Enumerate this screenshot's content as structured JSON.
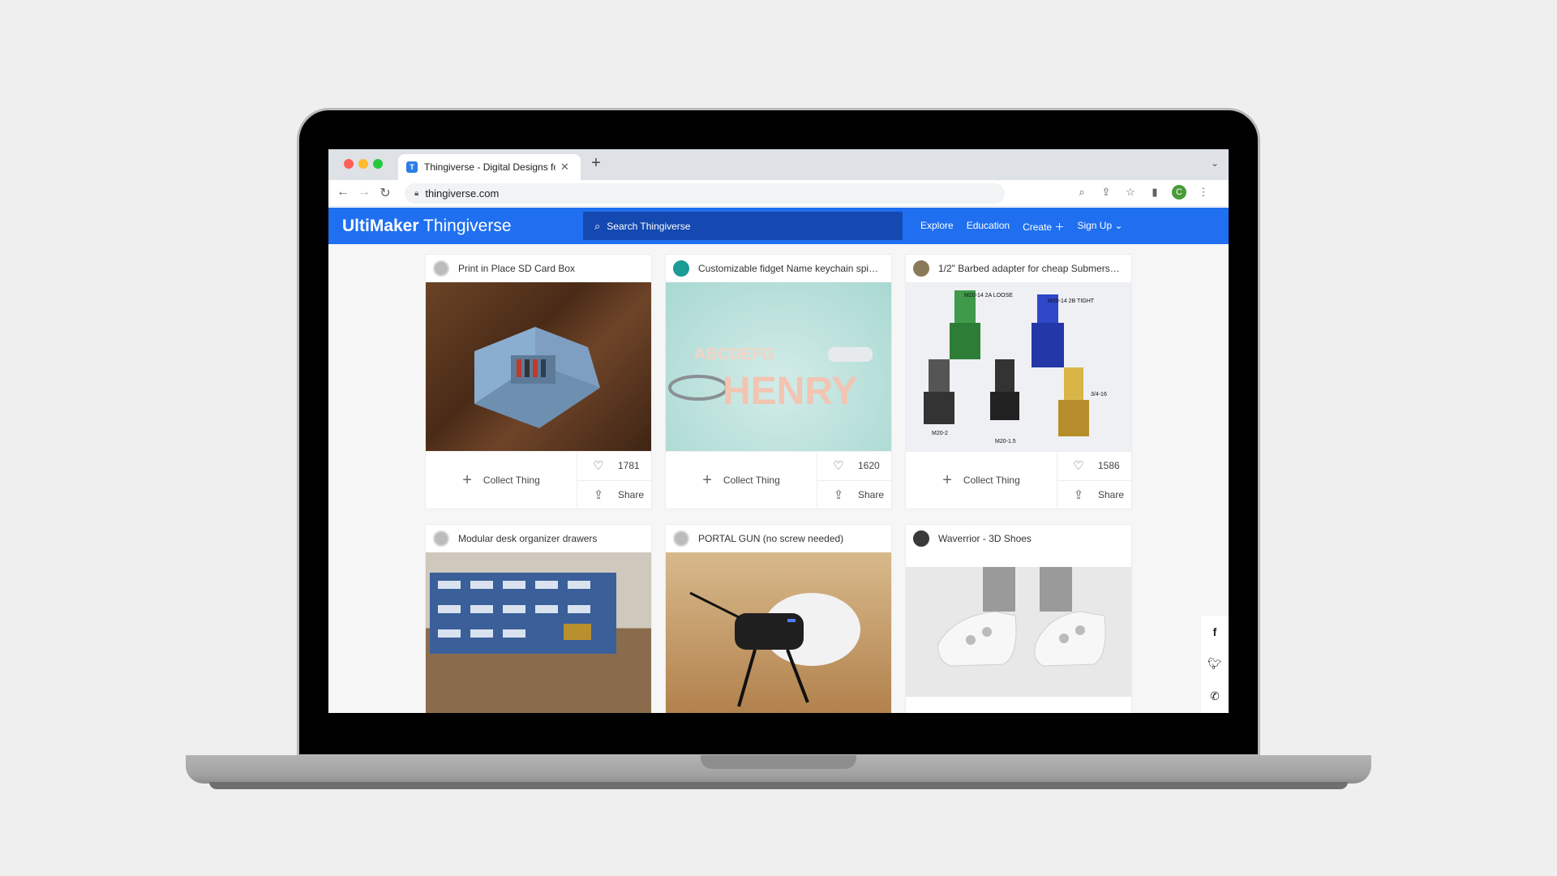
{
  "browser": {
    "tab_title": "Thingiverse - Digital Designs fo",
    "tab_favicon": "T",
    "url": "thingiverse.com",
    "profile_initial": "C"
  },
  "header": {
    "logo_bold": "UltiMaker",
    "logo_light": " Thingiverse",
    "search_placeholder": "Search Thingiverse",
    "nav": [
      "Explore",
      "Education",
      "Create",
      "Sign Up"
    ]
  },
  "cards": [
    {
      "title": "Print in Place SD Card Box",
      "collect": "Collect Thing",
      "likes": "1781",
      "share": "Share"
    },
    {
      "title": "Customizable fidget Name keychain spin...",
      "collect": "Collect Thing",
      "likes": "1620",
      "share": "Share"
    },
    {
      "title": "1/2\" Barbed adapter for cheap Submersib...",
      "collect": "Collect Thing",
      "likes": "1586",
      "share": "Share"
    },
    {
      "title": "Modular desk organizer drawers"
    },
    {
      "title": "PORTAL GUN (no screw needed)"
    },
    {
      "title": "Waverrior - 3D Shoes"
    }
  ],
  "image_labels": {
    "name": "HENRY",
    "letters": "ABCDEFG",
    "adapter_a": "M20-14 2A LOOSE",
    "adapter_b": "M20-14 2B TIGHT",
    "adapter_c": "3/4-16",
    "adapter_d": "M20-2",
    "adapter_e": "M20-1.5"
  },
  "share_rail": [
    "f",
    "t",
    "w"
  ]
}
